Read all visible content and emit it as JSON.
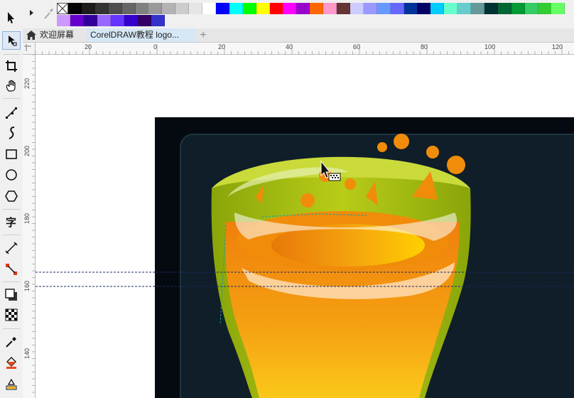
{
  "tabs": [
    {
      "label": "欢迎屏幕",
      "icon": "home-icon"
    },
    {
      "label": "CorelDRAW教程 logo..."
    }
  ],
  "add_tab_label": "+",
  "ruler_h_labels": [
    "20",
    "0",
    "20",
    "40",
    "60",
    "80",
    "100",
    "120"
  ],
  "ruler_v_labels": [
    "220",
    "200",
    "180",
    "160",
    "140"
  ],
  "palette": {
    "row1": [
      "#000000",
      "#1c1c1c",
      "#333333",
      "#4d4d4d",
      "#666666",
      "#808080",
      "#999999",
      "#b3b3b3",
      "#cccccc",
      "#e6e6e6",
      "#ffffff",
      "#0000ff",
      "#00ffff",
      "#00ff00",
      "#ffff00",
      "#ff0000",
      "#ff00ff",
      "#9900cc",
      "#ff6600",
      "#ff99cc",
      "#663333",
      "#ccccff",
      "#9999ff",
      "#6699ff",
      "#6666ff",
      "#003399",
      "#000066",
      "#00ccff",
      "#66ffcc",
      "#66cccc",
      "#669999",
      "#003333",
      "#006633",
      "#009933",
      "#33cc66",
      "#33cc33",
      "#66ff66"
    ],
    "row2": [
      "#cc99ff",
      "#6600cc",
      "#330099",
      "#9966ff",
      "#6633ff",
      "#3300cc",
      "#330066",
      "#3333cc"
    ]
  },
  "tools": [
    "pick-tool",
    "shape-tool",
    "crop-tool",
    "pan-tool",
    "freehand-tool",
    "artistic-media-tool",
    "rectangle-tool",
    "ellipse-tool",
    "polygon-tool",
    "text-tool",
    "dimension-tool",
    "connector-tool",
    "drop-shadow-tool",
    "transparency-tool",
    "eyedropper-tool",
    "fill-tool",
    "smart-fill-tool"
  ],
  "colors": {
    "background_dark": "#050a10",
    "panel": "#0f1e28",
    "glass_rim": "#a8c20c",
    "juice_orange": "#f08c0a",
    "juice_yellow": "#ffd400"
  }
}
